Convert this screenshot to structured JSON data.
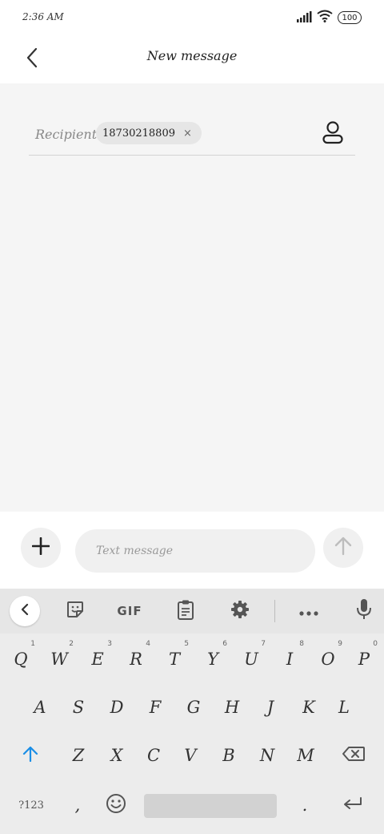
{
  "status_bar": {
    "time": "2:36 AM",
    "battery": "100",
    "signal_icon": "signal-icon",
    "wifi_icon": "wifi-icon"
  },
  "header": {
    "title": "New message",
    "back_icon": "back-arrow-icon"
  },
  "recipient": {
    "label": "Recipient:",
    "chip_value": "18730218809",
    "chip_remove": "×",
    "contact_icon": "person-icon"
  },
  "composer": {
    "placeholder": "Text message",
    "add_icon": "plus-icon",
    "send_icon": "send-arrow-icon"
  },
  "keyboard_toolbar": {
    "gif_label": "GIF",
    "icons": [
      "chevron-left-icon",
      "sticker-icon",
      "clipboard-icon",
      "gear-icon",
      "more-icon",
      "mic-icon"
    ]
  },
  "keyboard": {
    "row1": [
      "Q",
      "W",
      "E",
      "R",
      "T",
      "Y",
      "U",
      "I",
      "O",
      "P"
    ],
    "row1_hints": [
      "1",
      "2",
      "3",
      "4",
      "5",
      "6",
      "7",
      "8",
      "9",
      "0"
    ],
    "row2": [
      "A",
      "S",
      "D",
      "F",
      "G",
      "H",
      "J",
      "K",
      "L"
    ],
    "row3": [
      "Z",
      "X",
      "C",
      "V",
      "B",
      "N",
      "M"
    ],
    "symbols_key": "?123",
    "comma_key": ",",
    "period_key": ".",
    "shift_icon": "shift-icon",
    "backspace_icon": "backspace-icon",
    "emoji_icon": "emoji-icon",
    "enter_icon": "enter-icon"
  },
  "colors": {
    "accent": "#1a8ee6",
    "background": "#f5f5f5",
    "keyboard": "#ececec"
  }
}
